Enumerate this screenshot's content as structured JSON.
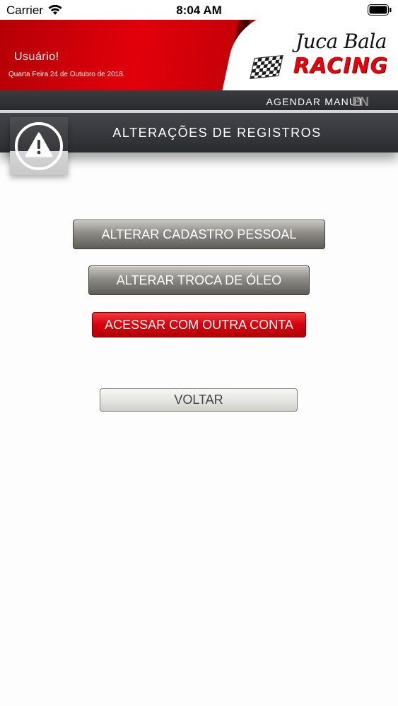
{
  "status_bar": {
    "carrier": "Carrier",
    "time": "8:04 AM"
  },
  "header": {
    "user_label": "Usuário!",
    "date": "Quarta Feira 24 de Outubro de 2018.",
    "logo": {
      "title": "Juca Bala",
      "subtitle": "RACING"
    }
  },
  "nav": {
    "item_label": "AGENDAR MANUT",
    "item_label_faded": "EN"
  },
  "section": {
    "title": "ALTERAÇÕES DE REGISTROS",
    "icon": "warning-icon"
  },
  "buttons": {
    "change_profile": "ALTERAR CADASTRO PESSOAL",
    "change_oil": "ALTERAR TROCA DE ÓLEO",
    "switch_account": "ACESSAR COM OUTRA CONTA",
    "back": "VOLTAR"
  },
  "colors": {
    "brand_red": "#e2000a",
    "bar_dark": "#2f3034",
    "background": "#fdfdfd"
  }
}
